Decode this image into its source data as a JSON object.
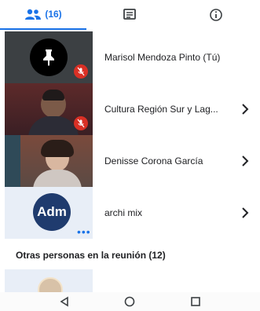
{
  "tabs": {
    "people_count": "(16)"
  },
  "participants": [
    {
      "name": "Marisol Mendoza Pinto (Tú)"
    },
    {
      "name": "Cultura Región Sur y Lag..."
    },
    {
      "name": "Denisse Corona García"
    },
    {
      "name": "archi mix",
      "avatar_text": "Adm"
    }
  ],
  "others": {
    "heading": "Otras personas en la reunión (12)"
  },
  "colors": {
    "accent": "#1a73e8",
    "muted": "#d93025"
  }
}
